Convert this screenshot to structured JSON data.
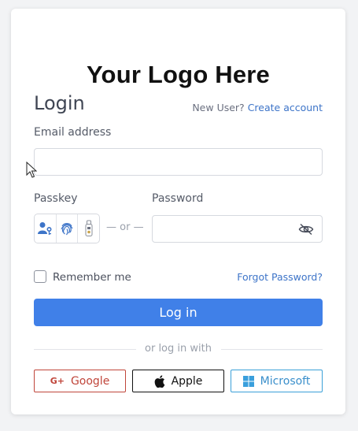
{
  "logo_text": "Your Logo Here",
  "title": "Login",
  "new_user": {
    "prompt": "New User?",
    "link": "Create account"
  },
  "email": {
    "label": "Email address",
    "value": ""
  },
  "passkey": {
    "label": "Passkey",
    "icons": [
      "user-key-icon",
      "fingerprint-icon",
      "usb-key-icon"
    ]
  },
  "or_text": "or",
  "password": {
    "label": "Password",
    "value": "",
    "toggle_icon": "eye-slash-icon"
  },
  "remember_me": {
    "label": "Remember me",
    "checked": false
  },
  "forgot_password": "Forgot Password?",
  "login_button": "Log in",
  "alt_login_text": "or log in with",
  "social": {
    "google": {
      "label": "Google",
      "color": "#c0453a"
    },
    "apple": {
      "label": "Apple",
      "color": "#111111"
    },
    "microsoft": {
      "label": "Microsoft",
      "color": "#3a8fcb"
    }
  },
  "colors": {
    "accent": "#4080e8",
    "link": "#3d74c8"
  }
}
